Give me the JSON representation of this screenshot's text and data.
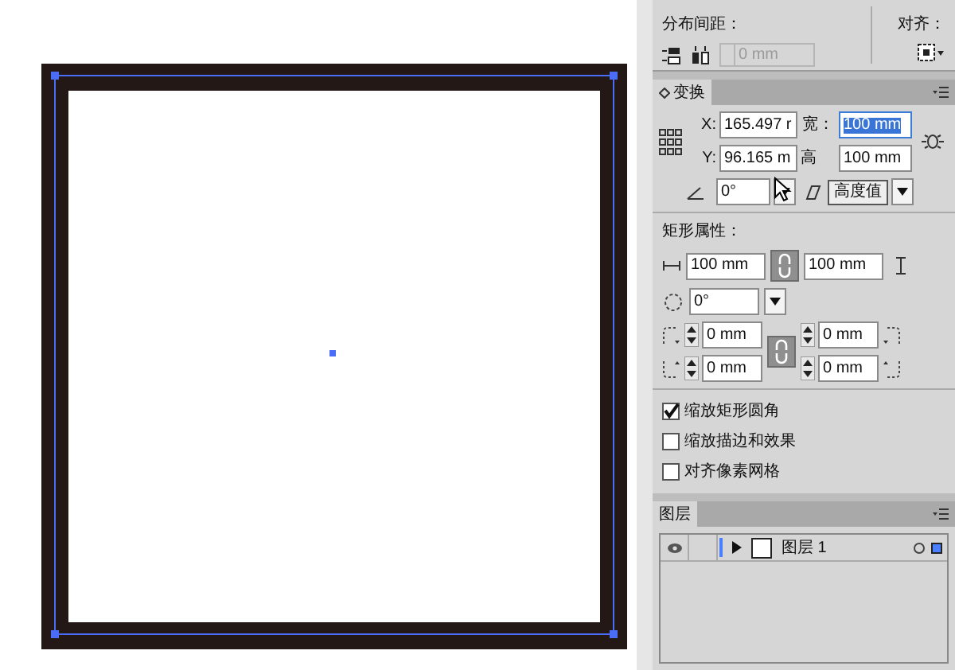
{
  "distribute": {
    "label": "分布间距：",
    "spacing": {
      "value": "0 mm",
      "disabled": true
    }
  },
  "align": {
    "label": "对齐："
  },
  "transform": {
    "tab": "变换",
    "x_label": "X:",
    "x": "165.497 r",
    "width_label": "宽：",
    "width": {
      "value": "100 mm",
      "selected": true
    },
    "y_label": "Y:",
    "y": "96.165 m",
    "height_label": "高",
    "height": "100 mm",
    "angle": "0°",
    "tooltip": "高度值"
  },
  "rect_props": {
    "title": "矩形属性：",
    "width": "100 mm",
    "height": "100 mm",
    "rotation": "0°",
    "corners": [
      "0 mm",
      "0 mm",
      "0 mm",
      "0 mm"
    ]
  },
  "options": [
    {
      "label": "缩放矩形圆角",
      "checked": true
    },
    {
      "label": "缩放描边和效果",
      "checked": false
    },
    {
      "label": "对齐像素网格",
      "checked": false
    }
  ],
  "layers": {
    "tab": "图层",
    "rows": [
      {
        "name": "图层 1",
        "visible": true,
        "color": "#4a7fff"
      }
    ]
  }
}
